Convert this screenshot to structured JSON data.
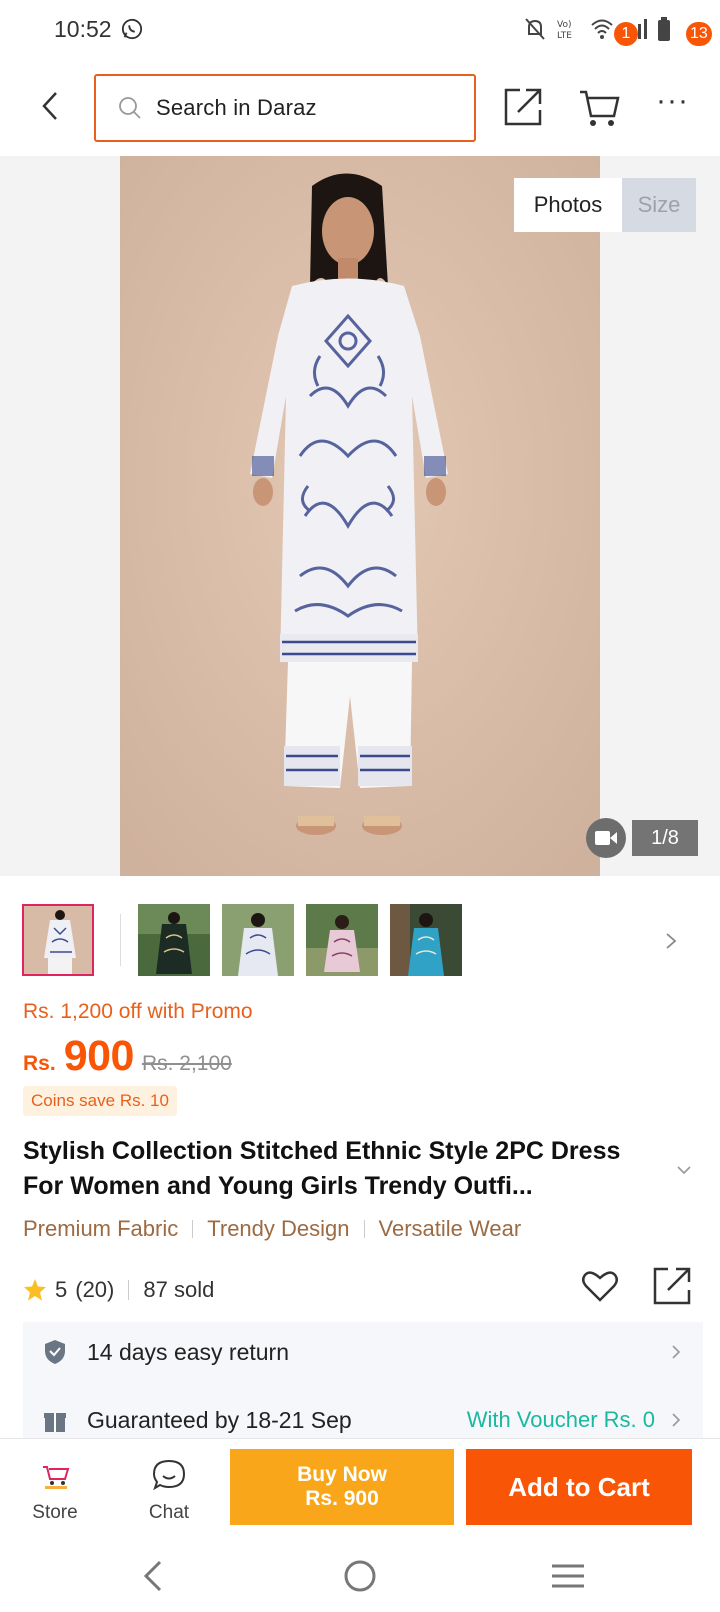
{
  "status_bar": {
    "time": "10:52"
  },
  "header": {
    "search_placeholder": "Search in Daraz",
    "cart_count": "1",
    "more_count": "13"
  },
  "gallery": {
    "tabs": [
      "Photos",
      "Size"
    ],
    "active_tab": "Photos",
    "counter": "1/8"
  },
  "product": {
    "promo": "Rs. 1,200 off with Promo",
    "currency": "Rs.",
    "price": "900",
    "original_price": "Rs. 2,100",
    "coins": "Coins save Rs. 10",
    "title": "Stylish Collection Stitched Ethnic Style 2PC Dress For Women and Young Girls Trendy Outfi...",
    "features": [
      "Premium Fabric",
      "Trendy Design",
      "Versatile Wear"
    ],
    "rating": "5",
    "reviews": "(20)",
    "sold": "87 sold"
  },
  "services": [
    {
      "label": "14 days easy return",
      "right": ""
    },
    {
      "label": "Guaranteed by 18-21 Sep",
      "right": "With Voucher Rs. 0"
    }
  ],
  "bottom_bar": {
    "store_label": "Store",
    "chat_label": "Chat",
    "buy_now_line1": "Buy Now",
    "buy_now_line2": "Rs. 900",
    "add_to_cart": "Add to Cart"
  },
  "colors": {
    "accent": "#f85606",
    "buy_now": "#faa61a",
    "feature_text": "#9c6b43",
    "voucher": "#1bb8a0"
  }
}
